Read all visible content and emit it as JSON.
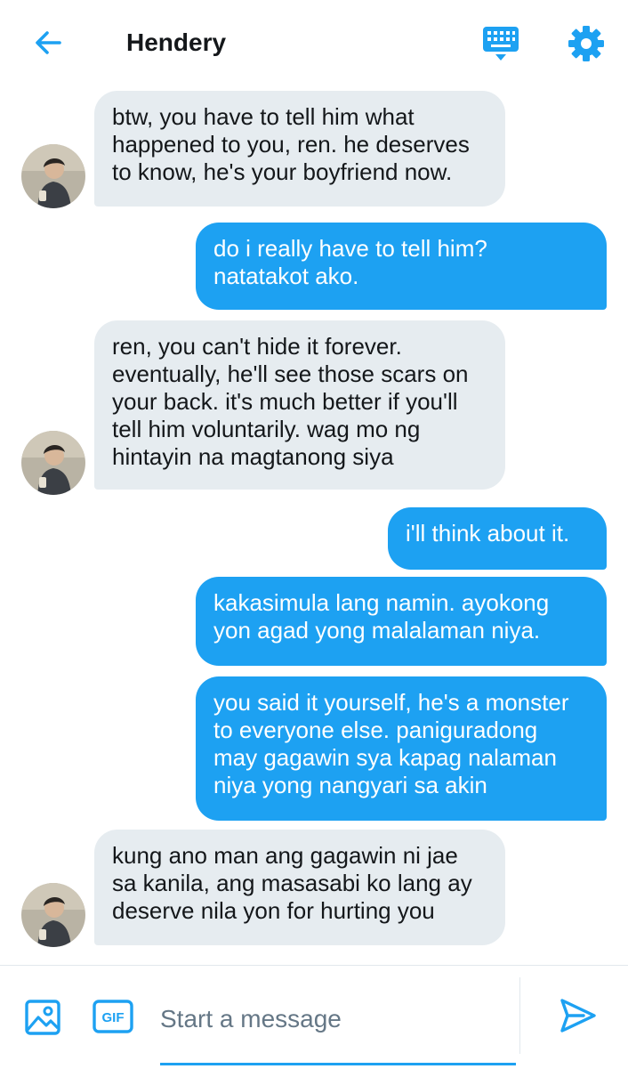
{
  "header": {
    "title": "Hendery"
  },
  "messages": [
    {
      "from": "in",
      "text": "btw, you have to tell him what\nhappened to you, ren. he deserves\nto know, he's your boyfriend now."
    },
    {
      "from": "out",
      "text": "do i really have to tell him?\nnatatakot ako."
    },
    {
      "from": "in",
      "text": "ren, you can't hide it forever.\neventually, he'll see those scars on\nyour back. it's much better if you'll\ntell him voluntarily. wag mo ng\nhintayin na magtanong siya"
    },
    {
      "from": "out",
      "text": "i'll think about it."
    },
    {
      "from": "out",
      "text": "kakasimula lang namin. ayokong\nyon agad yong malalaman niya."
    },
    {
      "from": "out",
      "text": "you said it yourself, he's a monster\nto everyone else. paniguradong\nmay gagawin sya kapag nalaman\nniya yong nangyari sa akin"
    },
    {
      "from": "in",
      "text": "kung ano man ang gagawin ni jae\nsa kanila, ang masasabi ko lang ay\ndeserve nila yon for hurting you"
    }
  ],
  "composer": {
    "placeholder": "Start a message",
    "gif_label": "GIF"
  },
  "icons": {
    "back": "arrow-left-icon",
    "keyboard": "keyboard-icon",
    "settings": "gear-icon",
    "image": "image-icon",
    "gif": "gif-icon",
    "send": "send-icon"
  },
  "colors": {
    "accent": "#1da1f2",
    "incoming_bubble": "#e6ecf0",
    "text": "#14171a"
  }
}
